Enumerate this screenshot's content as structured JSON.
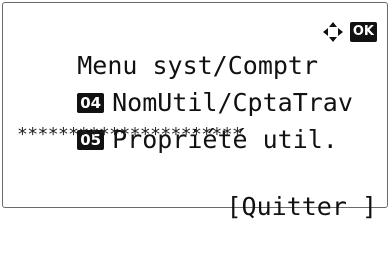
{
  "screen": {
    "title": "Menu syst/Comptr",
    "ok_label": "OK",
    "nav_icon": "four-way-arrow-icon",
    "items": [
      {
        "number": "04",
        "label": "NomUtil/CptaTrav"
      },
      {
        "number": "05",
        "label": "Propriété util."
      }
    ],
    "mask": "**********************",
    "softkey_label": "[Quitter ]"
  }
}
